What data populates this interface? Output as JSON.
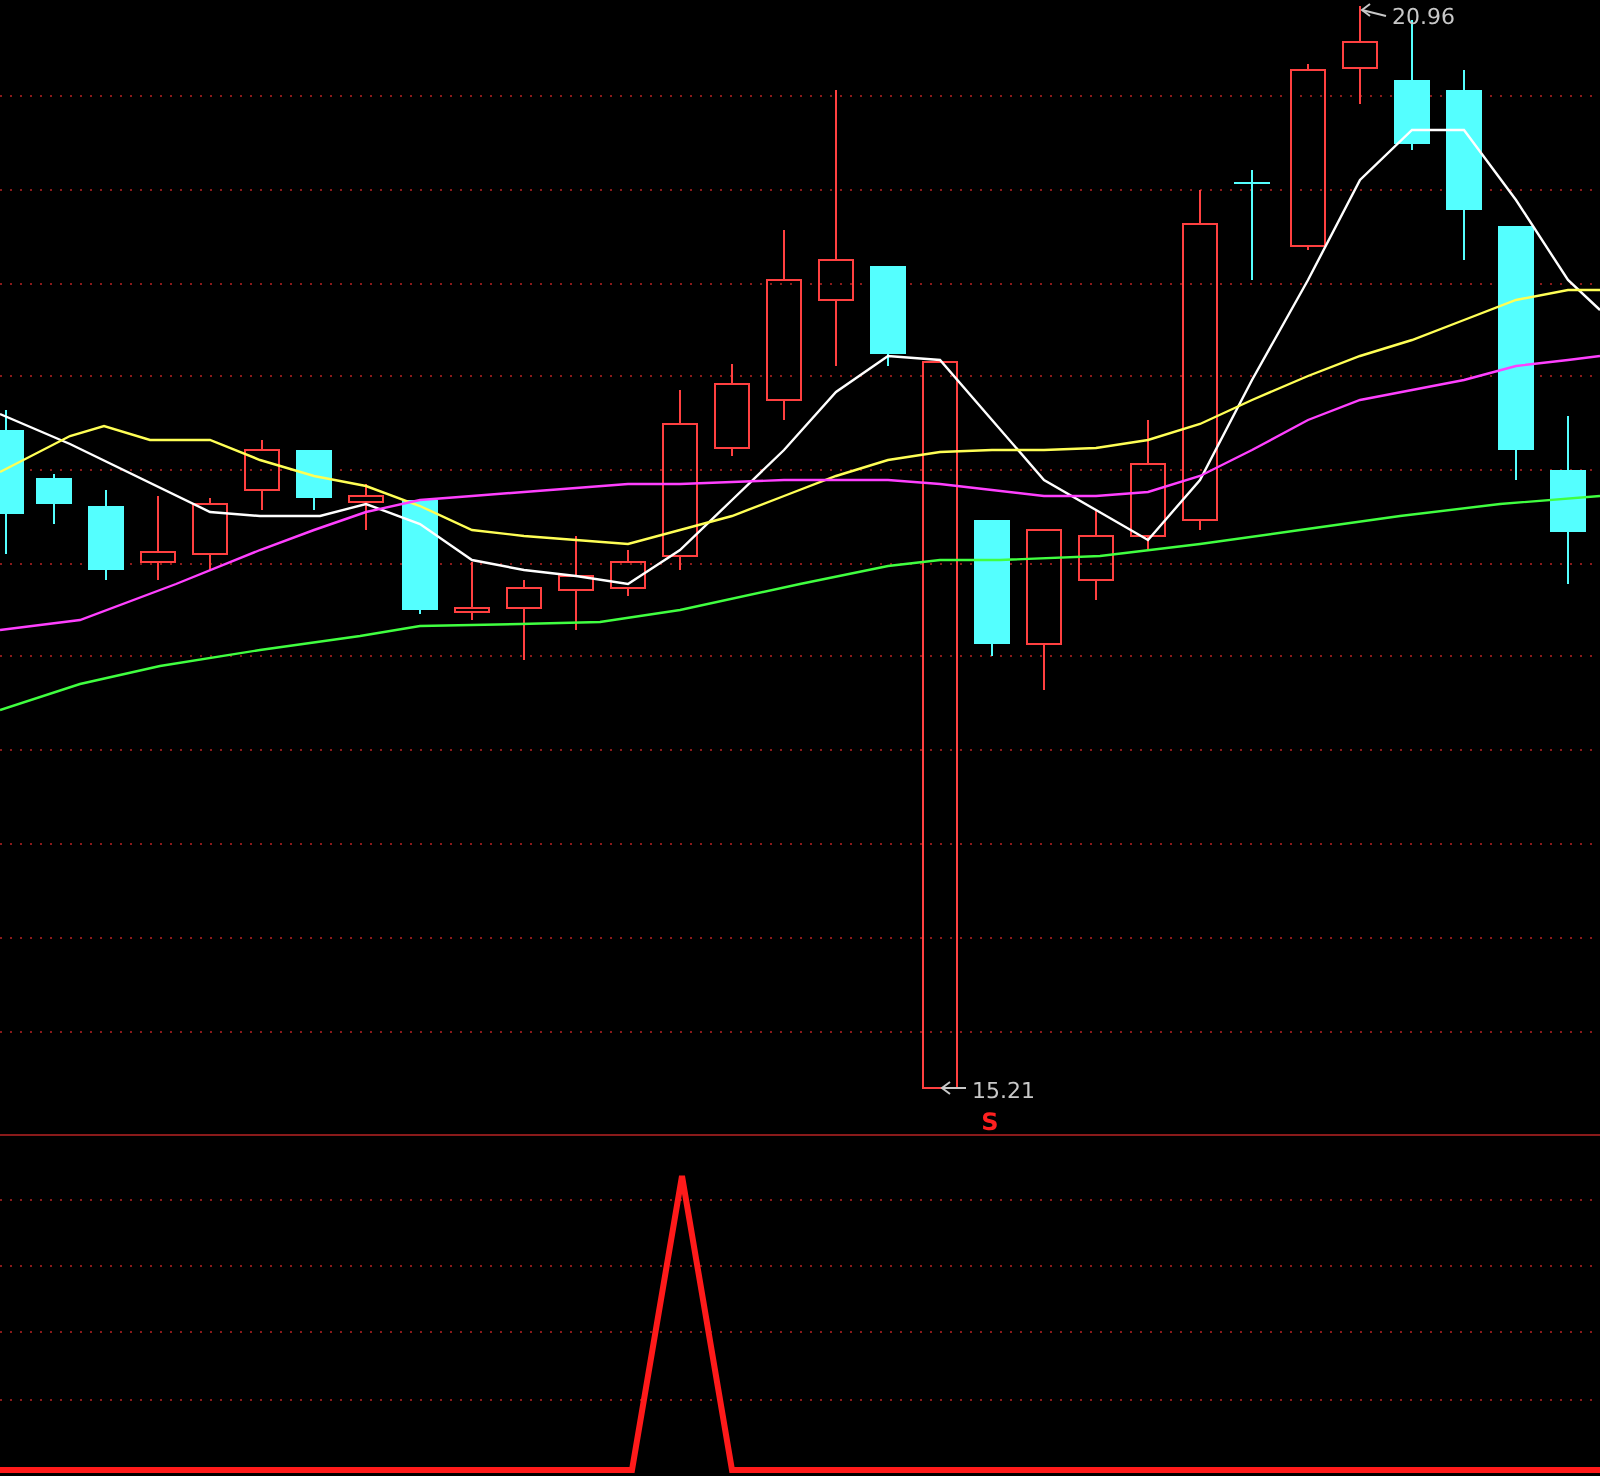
{
  "price_chart": {
    "high_label": "20.96",
    "low_label": "15.21"
  },
  "signal_panel": {
    "signal_mark": "S"
  }
}
